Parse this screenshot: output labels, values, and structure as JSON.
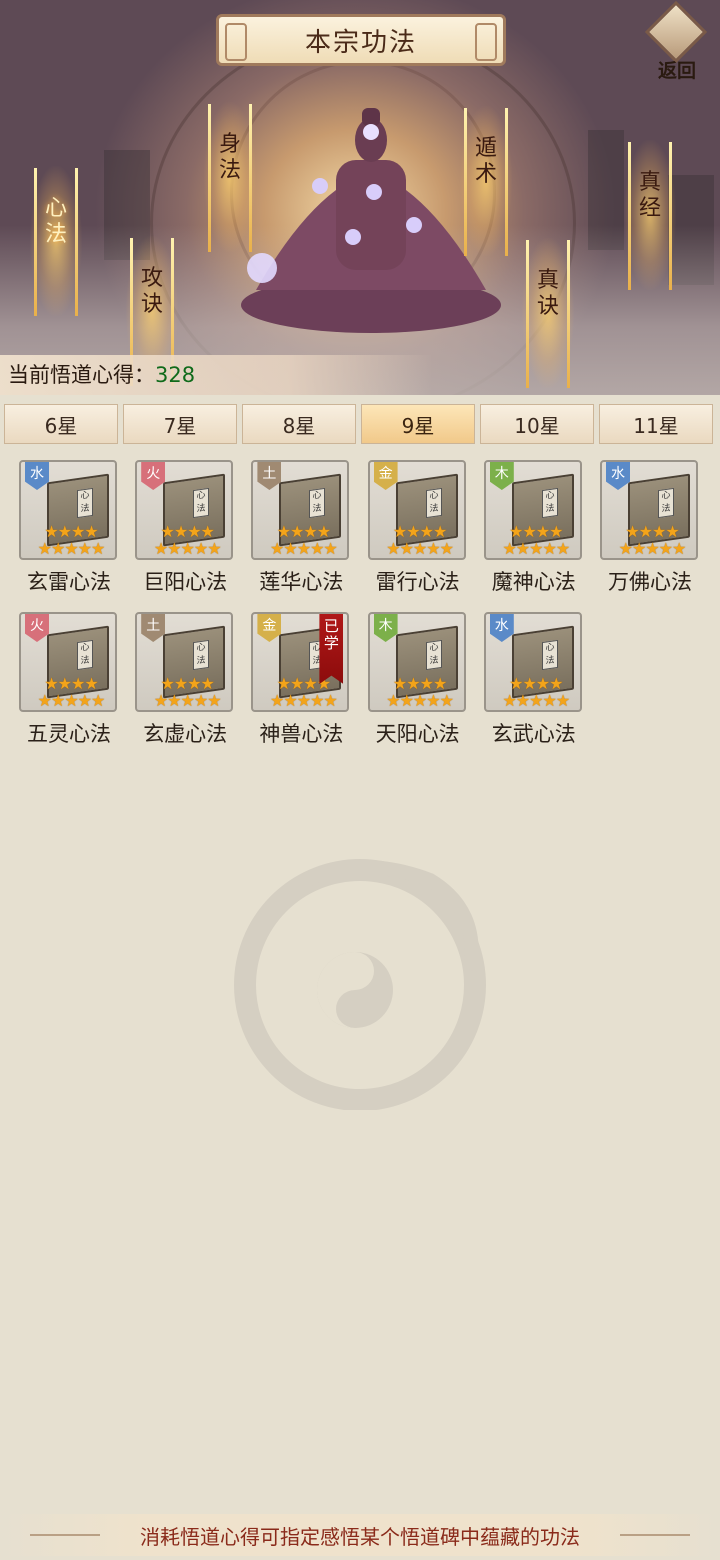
{
  "header": {
    "title": "本宗功法",
    "back_label": "返回"
  },
  "skills": [
    {
      "label": "心法",
      "active": true
    },
    {
      "label": "攻诀",
      "active": false
    },
    {
      "label": "身法",
      "active": false
    },
    {
      "label": "遁术",
      "active": false
    },
    {
      "label": "真诀",
      "active": false
    },
    {
      "label": "真经",
      "active": false
    }
  ],
  "points": {
    "label": "当前悟道心得：",
    "value": "328"
  },
  "tabs": [
    {
      "label": "6星",
      "selected": false
    },
    {
      "label": "7星",
      "selected": false
    },
    {
      "label": "8星",
      "selected": false
    },
    {
      "label": "9星",
      "selected": true
    },
    {
      "label": "10星",
      "selected": false
    },
    {
      "label": "11星",
      "selected": false
    }
  ],
  "items": [
    {
      "name": "玄雷心法",
      "element": "水",
      "stars": 9,
      "learned": false
    },
    {
      "name": "巨阳心法",
      "element": "火",
      "stars": 9,
      "learned": false
    },
    {
      "name": "莲华心法",
      "element": "土",
      "stars": 9,
      "learned": false
    },
    {
      "name": "雷行心法",
      "element": "金",
      "stars": 9,
      "learned": false
    },
    {
      "name": "魔神心法",
      "element": "木",
      "stars": 9,
      "learned": false
    },
    {
      "name": "万佛心法",
      "element": "水",
      "stars": 9,
      "learned": false
    },
    {
      "name": "五灵心法",
      "element": "火",
      "stars": 9,
      "learned": false
    },
    {
      "name": "玄虚心法",
      "element": "土",
      "stars": 9,
      "learned": false
    },
    {
      "name": "神兽心法",
      "element": "金",
      "stars": 9,
      "learned": true
    },
    {
      "name": "天阳心法",
      "element": "木",
      "stars": 9,
      "learned": false
    },
    {
      "name": "玄武心法",
      "element": "水",
      "stars": 9,
      "learned": false
    }
  ],
  "learned_badge": "已学",
  "book_seal": "心法",
  "footer": {
    "message": "消耗悟道心得可指定感悟某个悟道碑中蕴藏的功法"
  },
  "colors": {
    "accent_selected_tab": "#f1c98a",
    "points_value": "#0f6a1a",
    "footer_text": "#8a2a1a",
    "learned_badge": "#b01818",
    "star": "#f3a41a"
  }
}
